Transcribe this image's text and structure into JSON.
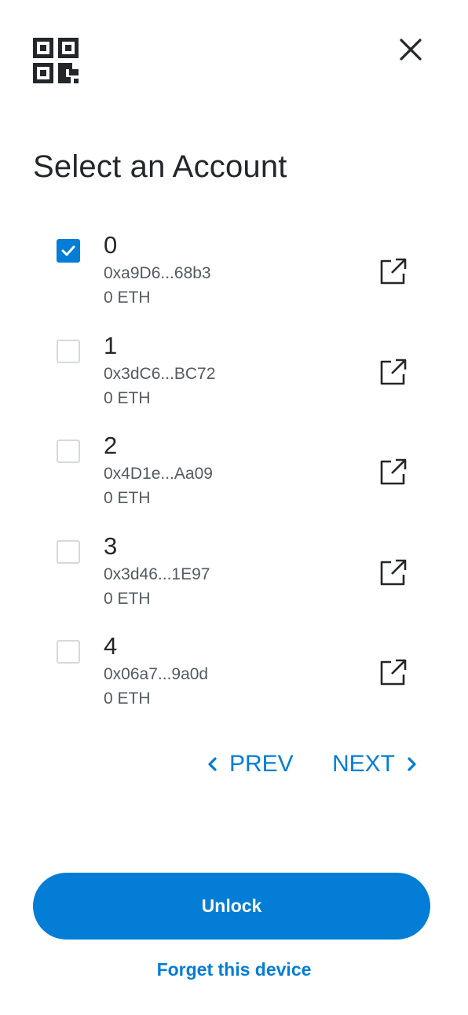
{
  "header": {
    "qr_icon": "qr-code-icon",
    "close_icon": "close-icon"
  },
  "title": "Select an Account",
  "accounts": [
    {
      "index": "0",
      "address": "0xa9D6...68b3",
      "balance": "0 ETH",
      "checked": true
    },
    {
      "index": "1",
      "address": "0x3dC6...BC72",
      "balance": "0 ETH",
      "checked": false
    },
    {
      "index": "2",
      "address": "0x4D1e...Aa09",
      "balance": "0 ETH",
      "checked": false
    },
    {
      "index": "3",
      "address": "0x3d46...1E97",
      "balance": "0 ETH",
      "checked": false
    },
    {
      "index": "4",
      "address": "0x06a7...9a0d",
      "balance": "0 ETH",
      "checked": false
    }
  ],
  "pagination": {
    "prev_label": "PREV",
    "next_label": "NEXT"
  },
  "unlock_label": "Unlock",
  "forget_label": "Forget this device",
  "colors": {
    "accent": "#037dd6",
    "text": "#24272a",
    "muted": "#535a61",
    "checkbox_border": "#d6d9dc"
  }
}
